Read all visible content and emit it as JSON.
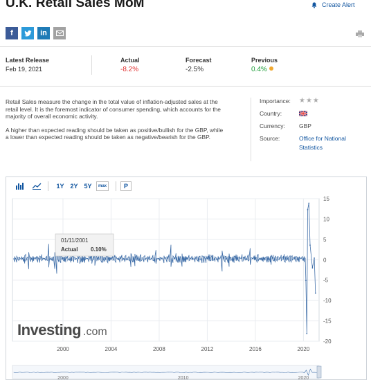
{
  "header": {
    "title": "U.K. Retail Sales MoM",
    "create_alert_label": "Create Alert"
  },
  "social": {
    "facebook": "f",
    "twitter": "t",
    "linkedin": "in",
    "email": "✉"
  },
  "release": {
    "latest_label": "Latest Release",
    "latest_date": "Feb 19, 2021",
    "actual_label": "Actual",
    "actual_value": "-8.2%",
    "forecast_label": "Forecast",
    "forecast_value": "-2.5%",
    "previous_label": "Previous",
    "previous_value": "0.4%"
  },
  "description": {
    "para1": "Retail Sales measure the change in the total value of inflation-adjusted sales at the retail level. It is the foremost indicator of consumer spending, which accounts for the majority of overall economic activity.",
    "para2": "A higher than expected reading should be taken as positive/bullish for the GBP, while a lower than expected reading should be taken as negative/bearish for the GBP."
  },
  "meta": {
    "importance_label": "Importance:",
    "importance_stars": "★★★",
    "country_label": "Country:",
    "currency_label": "Currency:",
    "currency_value": "GBP",
    "source_label": "Source:",
    "source_value_line1": "Office for National",
    "source_value_line2": "Statistics"
  },
  "toolbar": {
    "range_1y": "1Y",
    "range_2y": "2Y",
    "range_5y": "5Y",
    "range_max": "max",
    "p_button": "P"
  },
  "tooltip": {
    "date": "01/11/2001",
    "label": "Actual",
    "value": "0.10%"
  },
  "watermark": {
    "brand": "Investing",
    "suffix": ".com"
  },
  "colors": {
    "line": "#3f6ea8",
    "link": "#1256a0",
    "red": "#e03030",
    "green": "#1c9c38"
  },
  "chart_data": {
    "type": "line",
    "series": [
      {
        "values": [
          [
            1996,
            0.3
          ],
          [
            1998,
            0.2
          ],
          [
            2000,
            0.4
          ],
          [
            2001.84,
            0.1
          ],
          [
            2004,
            0.2
          ],
          [
            2008,
            0.2
          ],
          [
            2012,
            0.3
          ],
          [
            2016,
            0.4
          ],
          [
            2019.5,
            0.2
          ],
          [
            2020.2,
            -5.1
          ],
          [
            2020.28,
            -18.1
          ],
          [
            2020.35,
            12.3
          ],
          [
            2020.45,
            13.9
          ],
          [
            2020.55,
            3.6
          ],
          [
            2020.75,
            -2.0
          ],
          [
            2020.9,
            0.4
          ],
          [
            2021.0,
            -8.2
          ]
        ]
      }
    ],
    "xlim": [
      1995.8,
      2021.3
    ],
    "ylim": [
      -20,
      15
    ],
    "x_ticks": [
      "2000",
      "2004",
      "2008",
      "2012",
      "2016",
      "2020"
    ],
    "y_ticks": [
      "15",
      "10",
      "5",
      "0",
      "-5",
      "-10",
      "-15",
      "-20"
    ],
    "navigator_ticks": [
      "2000",
      "2010",
      "2020"
    ],
    "grid": true
  }
}
